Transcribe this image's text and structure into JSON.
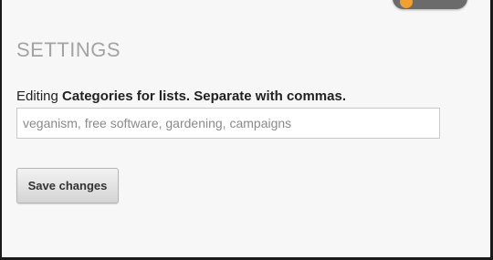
{
  "settings": {
    "title": "SETTINGS",
    "field_label_prefix": "Editing",
    "field_label_main": "Categories for lists. Separate with commas.",
    "input_placeholder": "veganism, free software, gardening, campaigns",
    "save_label": "Save changes"
  },
  "top_badge": {
    "icon": "orange-circle-icon"
  }
}
